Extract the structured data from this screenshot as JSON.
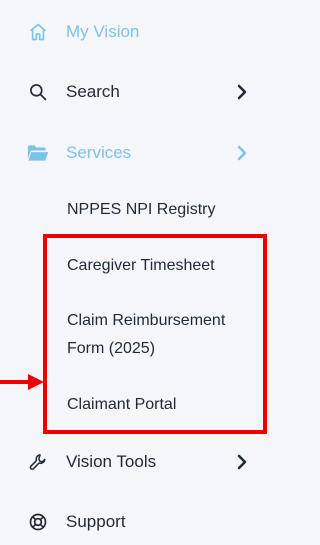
{
  "menu": {
    "my_vision": "My Vision",
    "search": "Search",
    "services": "Services",
    "vision_tools": "Vision Tools",
    "support": "Support"
  },
  "services_submenu": [
    "NPPES NPI Registry",
    "Caregiver Timesheet",
    "Claim Reimbursement",
    "Form (2025)",
    "Claimant Portal"
  ],
  "colors": {
    "active": "#7cc3e6",
    "highlight": "#ee0000",
    "text": "#1f2937",
    "background": "#f5f6f9"
  }
}
